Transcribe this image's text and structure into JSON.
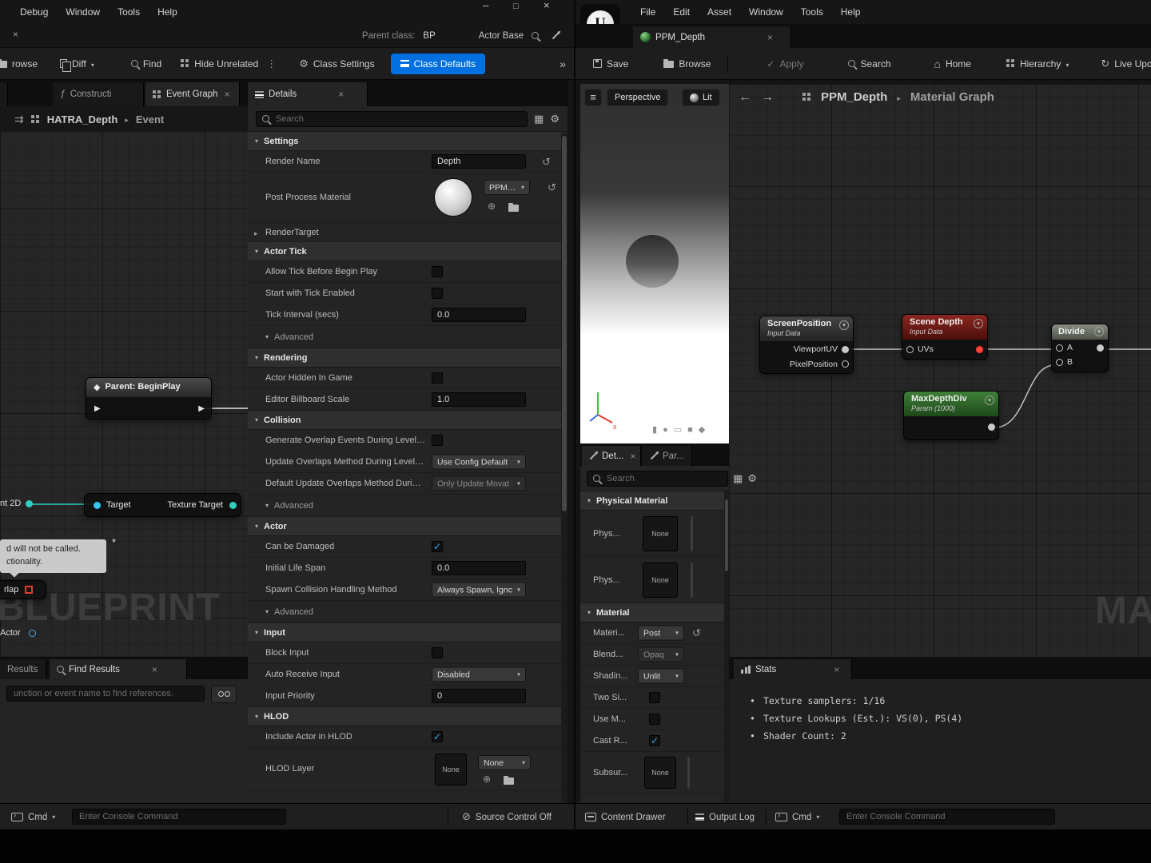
{
  "left": {
    "menu": [
      "Debug",
      "Window",
      "Tools",
      "Help"
    ],
    "parent_class_label": "Parent class:",
    "parent_class_value": "BP",
    "search_scope": "Actor Base",
    "toolbar": {
      "browse": "rowse",
      "diff": "Diff",
      "find": "Find",
      "hide_unrelated": "Hide Unrelated",
      "class_settings": "Class Settings",
      "class_defaults": "Class Defaults"
    },
    "tabs": {
      "construction": "Constructi",
      "event_graph": "Event Graph",
      "details": "Details"
    },
    "graph": {
      "breadcrumb_root": "HATRA_Depth",
      "breadcrumb_leaf": "Event",
      "watermark": "BLUEPRINT",
      "begin_play": "Parent: BeginPlay",
      "pin_partial": "nt 2D",
      "target_in": "Target",
      "target_out": "Texture Target",
      "comment_line1": "d will not be called.",
      "comment_line2": "ctionality.",
      "overlap_partial": "rlap",
      "actor_partial": "Actor"
    },
    "find_results": {
      "tab_left": "Results",
      "tab_active": "Find Results",
      "placeholder": "unction or event name to find references."
    },
    "status": {
      "cmd": "Cmd",
      "console_placeholder": "Enter Console Command",
      "source_control": "Source Control Off"
    },
    "details": {
      "search_placeholder": "Search",
      "settings": {
        "header": "Settings",
        "render_name": "Render Name",
        "render_name_value": "Depth",
        "ppm": "Post Process Material",
        "ppm_value": "PPM_D",
        "render_target": "RenderTarget"
      },
      "actor_tick": {
        "header": "Actor Tick",
        "allow_tick": "Allow Tick Before Begin Play",
        "start_tick": "Start with Tick Enabled",
        "tick_interval": "Tick Interval (secs)",
        "tick_interval_value": "0.0",
        "advanced": "Advanced"
      },
      "rendering": {
        "header": "Rendering",
        "hidden": "Actor Hidden In Game",
        "billboard": "Editor Billboard Scale",
        "billboard_value": "1.0"
      },
      "collision": {
        "header": "Collision",
        "gen_overlap": "Generate Overlap Events During Level Streaming",
        "update_overlaps": "Update Overlaps Method During Level Streaming",
        "update_overlaps_value": "Use Config Default",
        "default_update": "Default Update Overlaps Method During Level",
        "default_update_value": "Only Update Movat",
        "advanced": "Advanced"
      },
      "actor": {
        "header": "Actor",
        "can_damage": "Can be Damaged",
        "life_span": "Initial Life Span",
        "life_span_value": "0.0",
        "spawn_method": "Spawn Collision Handling Method",
        "spawn_method_value": "Always Spawn, Ignc",
        "advanced": "Advanced"
      },
      "input": {
        "header": "Input",
        "block_input": "Block Input",
        "auto_receive": "Auto Receive Input",
        "auto_receive_value": "Disabled",
        "input_priority": "Input Priority",
        "input_priority_value": "0"
      },
      "hlod": {
        "header": "HLOD",
        "include": "Include Actor in HLOD",
        "layer": "HLOD Layer",
        "layer_thumb": "None",
        "layer_value": "None"
      }
    }
  },
  "right": {
    "menu": [
      "File",
      "Edit",
      "Asset",
      "Window",
      "Tools",
      "Help"
    ],
    "tab": "PPM_Depth",
    "toolbar": {
      "save": "Save",
      "browse": "Browse",
      "apply": "Apply",
      "search": "Search",
      "home": "Home",
      "hierarchy": "Hierarchy",
      "live_update": "Live Update"
    },
    "viewport": {
      "perspective": "Perspective",
      "lit": "Lit"
    },
    "graph": {
      "breadcrumb_root": "PPM_Depth",
      "breadcrumb_leaf": "Material Graph",
      "watermark": "MA",
      "screen_position": {
        "title": "ScreenPosition",
        "subtitle": "Input Data",
        "pin1": "ViewportUV",
        "pin2": "PixelPosition"
      },
      "scene_depth": {
        "title": "Scene Depth",
        "subtitle": "Input Data",
        "pin": "UVs"
      },
      "divide": {
        "title": "Divide",
        "pin_a": "A",
        "pin_b": "B"
      },
      "max_depth_div": {
        "title": "MaxDepthDiv",
        "subtitle": "Param (1000)"
      }
    },
    "stats": {
      "tab": "Stats",
      "line1": "Texture samplers: 1/16",
      "line2": "Texture Lookups (Est.): VS(0), PS(4)",
      "line3": "Shader Count: 2"
    },
    "details": {
      "tab_details": "Det...",
      "tab_params": "Par...",
      "search_placeholder": "Search",
      "phys_header": "Physical Material",
      "phys1_label": "Phys...",
      "phys1_value": "None",
      "phys2_label": "Phys...",
      "phys2_value": "None",
      "mat_header": "Material",
      "mat1_label": "Materi...",
      "mat1_value": "Post",
      "mat2_label": "Blend...",
      "mat2_value": "Opaq",
      "mat3_label": "Shadin...",
      "mat3_value": "Unlit",
      "mat4_label": "Two Si...",
      "mat5_label": "Use M...",
      "mat6_label": "Cast R...",
      "mat7_label": "Subsur...",
      "mat7_value": "None"
    },
    "status": {
      "content_drawer": "Content Drawer",
      "output_log": "Output Log",
      "cmd": "Cmd",
      "console_placeholder": "Enter Console Command"
    }
  }
}
